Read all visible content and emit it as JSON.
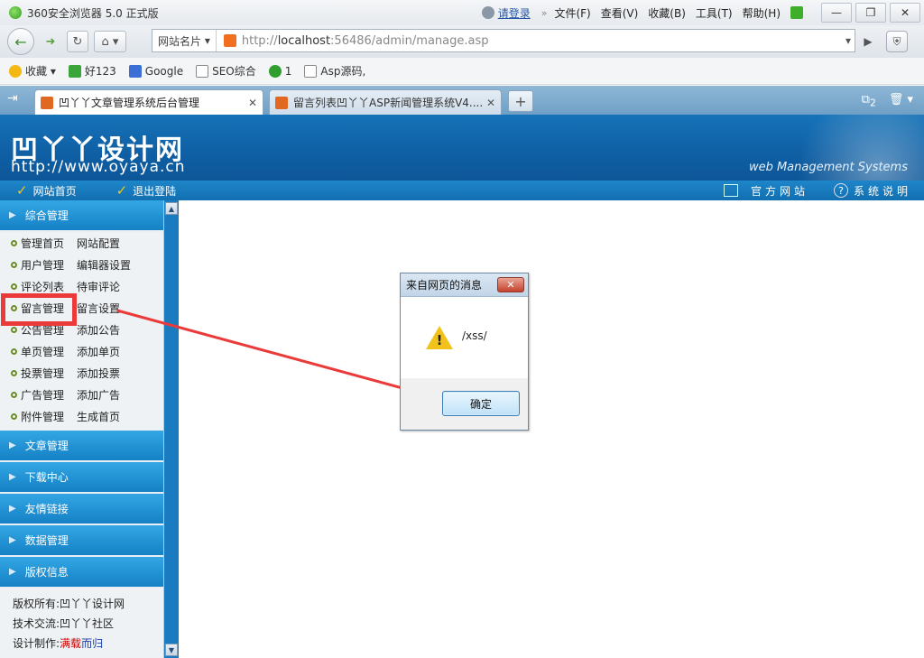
{
  "browser": {
    "title": "360安全浏览器 5.0 正式版",
    "login": "请登录",
    "menu": [
      "文件(F)",
      "查看(V)",
      "收藏(B)",
      "工具(T)",
      "帮助(H)"
    ],
    "site_card": "网站名片",
    "url_prefix": "http://",
    "url_host": "localhost",
    "url_rest": ":56486/admin/manage.asp",
    "favorites": [
      "收藏",
      "好123",
      "Google",
      "SEO综合",
      "1",
      "Asp源码,"
    ],
    "tabs": [
      {
        "label": "凹丫丫文章管理系统后台管理",
        "active": true
      },
      {
        "label": "留言列表凹丫丫ASP新闻管理系统V4....",
        "active": false
      }
    ],
    "tab_count": "2"
  },
  "site": {
    "brand_cn": "凹丫丫设计网",
    "brand_url": "http://www.oyaya.cn",
    "header_sub": "web Management Systems",
    "toolbar_left": [
      "网站首页",
      "退出登陆"
    ],
    "toolbar_right": [
      "官方网站",
      "系统说明"
    ]
  },
  "sidebar": {
    "open_section": "综合管理",
    "rows": [
      [
        "管理首页",
        "网站配置"
      ],
      [
        "用户管理",
        "编辑器设置"
      ],
      [
        "评论列表",
        "待审评论"
      ],
      [
        "留言管理",
        "留言设置"
      ],
      [
        "公告管理",
        "添加公告"
      ],
      [
        "单页管理",
        "添加单页"
      ],
      [
        "投票管理",
        "添加投票"
      ],
      [
        "广告管理",
        "添加广告"
      ],
      [
        "附件管理",
        "生成首页"
      ]
    ],
    "collapsed": [
      "文章管理",
      "下载中心",
      "友情链接",
      "数据管理",
      "版权信息"
    ],
    "copyright": {
      "owner_label": "版权所有:",
      "owner": "凹丫丫设计网",
      "tech_label": "技术交流:",
      "tech": "凹丫丫社区",
      "design_label": "设计制作:",
      "design_a": "满载",
      "design_b": "而归"
    }
  },
  "dialog": {
    "title": "来自网页的消息",
    "message": "/xss/",
    "ok": "确定"
  },
  "colors": {
    "header_blue": "#1773b8",
    "annotation_red": "#ea3a3a"
  }
}
